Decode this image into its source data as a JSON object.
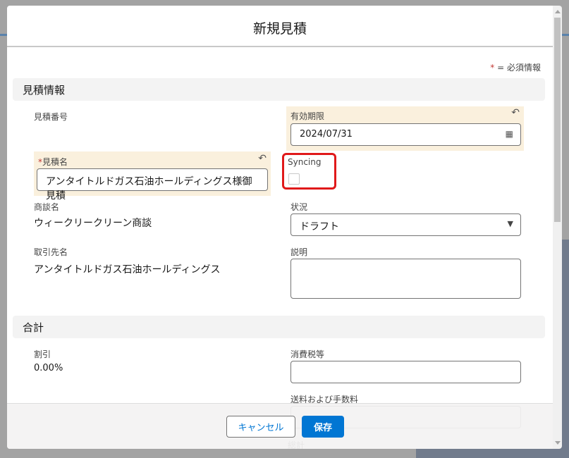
{
  "modal": {
    "title": "新規見積",
    "required_note_star": "*",
    "required_note": "= 必須情報"
  },
  "sections": {
    "quote_info": "見積情報",
    "totals": "合計"
  },
  "fields": {
    "quote_number": {
      "label": "見積番号"
    },
    "expiration": {
      "label": "有効期限",
      "value": "2024/07/31"
    },
    "quote_name": {
      "label": "見積名",
      "required": "*",
      "value": "アンタイトルドガス石油ホールディングス様御見積"
    },
    "syncing": {
      "label": "Syncing",
      "checked": false
    },
    "opportunity": {
      "label": "商談名",
      "value": "ウィークリークリーン商談"
    },
    "status": {
      "label": "状況",
      "value": "ドラフト"
    },
    "account": {
      "label": "取引先名",
      "value": "アンタイトルドガス石油ホールディングス"
    },
    "description": {
      "label": "説明",
      "value": ""
    },
    "discount": {
      "label": "割引",
      "value": "0.00%"
    },
    "tax": {
      "label": "消費税等",
      "value": ""
    },
    "shipping": {
      "label": "送料および手数料",
      "value": ""
    },
    "grand_total": {
      "label": "総計"
    }
  },
  "footer": {
    "cancel": "キャンセル",
    "save": "保存"
  },
  "colors": {
    "brand": "#0176d3",
    "highlight": "#faf0dd",
    "annotation": "#e0191a"
  }
}
